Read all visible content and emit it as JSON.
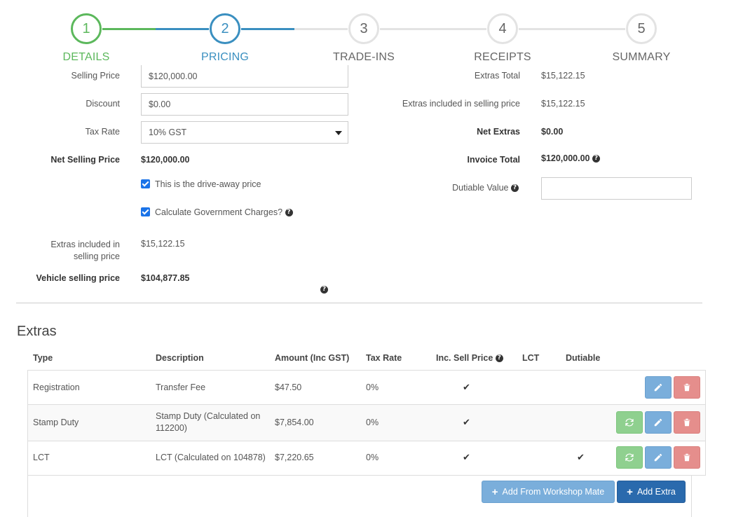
{
  "wizard": {
    "steps": [
      {
        "number": "1",
        "label": "DETAILS"
      },
      {
        "number": "2",
        "label": "PRICING"
      },
      {
        "number": "3",
        "label": "TRADE-INS"
      },
      {
        "number": "4",
        "label": "RECEIPTS"
      },
      {
        "number": "5",
        "label": "SUMMARY"
      }
    ]
  },
  "pricing": {
    "selling_price_label": "Selling Price",
    "selling_price_value": "$120,000.00",
    "discount_label": "Discount",
    "discount_value": "$0.00",
    "tax_rate_label": "Tax Rate",
    "tax_rate_value": "10% GST",
    "net_selling_price_label": "Net Selling Price",
    "net_selling_price_value": "$120,000.00",
    "drive_away_label": "This is the drive-away price",
    "gov_charges_label": "Calculate Government Charges?",
    "extras_included_label_line1": "Extras included in",
    "extras_included_label_line2": "selling price",
    "extras_included_value": "$15,122.15",
    "vehicle_selling_price_label": "Vehicle selling price",
    "vehicle_selling_price_value": "$104,877.85"
  },
  "summary": {
    "extras_total_label": "Extras Total",
    "extras_total_value": "$15,122.15",
    "extras_in_sell_label": "Extras included in selling price",
    "extras_in_sell_value": "$15,122.15",
    "net_extras_label": "Net Extras",
    "net_extras_value": "$0.00",
    "invoice_total_label": "Invoice Total",
    "invoice_total_value": "$120,000.00",
    "dutiable_value_label": "Dutiable Value",
    "dutiable_value_value": ""
  },
  "extras": {
    "heading": "Extras",
    "columns": {
      "type": "Type",
      "description": "Description",
      "amount": "Amount (Inc GST)",
      "tax_rate": "Tax Rate",
      "inc_sell_price": "Inc. Sell Price",
      "lct": "LCT",
      "dutiable": "Dutiable"
    },
    "rows": [
      {
        "type": "Registration",
        "description_line1": "Transfer Fee",
        "description_line2": "",
        "amount": "$47.50",
        "tax_rate": "0%"
      },
      {
        "type": "Stamp Duty",
        "description_line1": "Stamp Duty (Calculated on",
        "description_line2": "112200)",
        "amount": "$7,854.00",
        "tax_rate": "0%"
      },
      {
        "type": "LCT",
        "description_line1": "LCT (Calculated on 104878)",
        "description_line2": "",
        "amount": "$7,220.65",
        "tax_rate": "0%"
      }
    ],
    "check_glyph": "✔",
    "add_workshop_label": "Add From Workshop Mate",
    "add_extra_label": "Add Extra"
  },
  "colors": {
    "done": "#5cb85c",
    "active": "#3a8fc0",
    "pending": "#e3e3e3",
    "edit_button": "#7aaedb",
    "delete_button": "#e58e8c",
    "refresh_button": "#8fd08f",
    "primary_button": "#2a6aad"
  }
}
